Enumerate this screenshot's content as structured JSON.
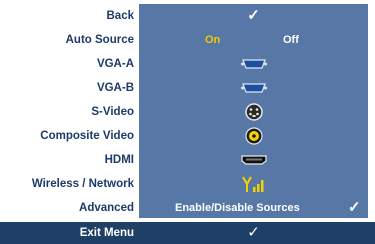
{
  "menu": {
    "rows": [
      {
        "label": "Back",
        "value_type": "check",
        "check": "✓"
      },
      {
        "label": "Auto Source",
        "on": "On",
        "off": "Off"
      },
      {
        "label": "VGA-A",
        "icon": "vga-connector-icon"
      },
      {
        "label": "VGA-B",
        "icon": "vga-connector-icon"
      },
      {
        "label": "S-Video",
        "icon": "svideo-connector-icon"
      },
      {
        "label": "Composite Video",
        "icon": "composite-connector-icon"
      },
      {
        "label": "HDMI",
        "icon": "hdmi-connector-icon"
      },
      {
        "label": "Wireless / Network",
        "icon": "wireless-signal-icon"
      },
      {
        "label": "Advanced",
        "text": "Enable/Disable Sources",
        "check": "✓"
      }
    ],
    "exit": {
      "label": "Exit Menu",
      "check": "✓"
    }
  },
  "colors": {
    "label_text": "#1e3a6a",
    "value_panel": "#5778a6",
    "bottom_bar": "#1e3f66",
    "on_selected": "#f6c800"
  }
}
